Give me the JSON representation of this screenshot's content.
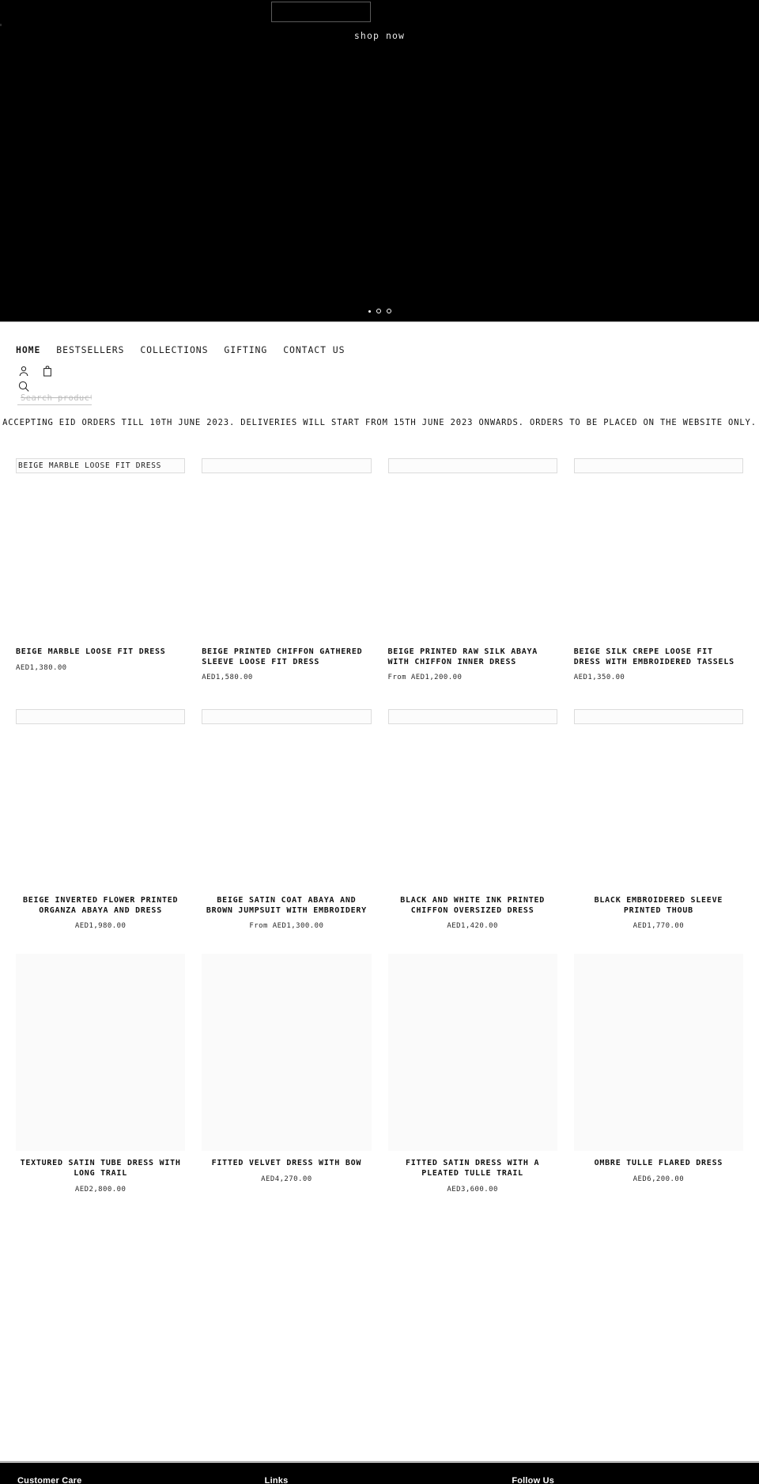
{
  "hero": {
    "shop_now_label": "shop now",
    "slider_dots": [
      "dot",
      "ring",
      "ring"
    ],
    "background_color": "#000000"
  },
  "header": {
    "nav": [
      {
        "label": "HOME",
        "active": true
      },
      {
        "label": "BESTSELLERS",
        "active": false
      },
      {
        "label": "COLLECTIONS",
        "active": false
      },
      {
        "label": "GIFTING",
        "active": false
      },
      {
        "label": "CONTACT US",
        "active": false
      }
    ],
    "icons": [
      {
        "name": "account-icon"
      },
      {
        "name": "bag-icon"
      },
      {
        "name": "search-icon"
      }
    ],
    "search": {
      "placeholder": "Search product",
      "value": ""
    },
    "announcement": "ACCEPTING EID ORDERS TILL 10TH JUNE 2023. DELIVERIES WILL START FROM 15TH JUNE 2023 ONWARDS. ORDERS TO BE PLACED ON THE WEBSITE ONLY."
  },
  "products": {
    "row1": [
      {
        "alt": "BEIGE MARBLE LOOSE FIT DRESS",
        "title": "BEIGE MARBLE LOOSE FIT DRESS",
        "price": "AED1,380.00"
      },
      {
        "alt": "",
        "title": "BEIGE PRINTED CHIFFON GATHERED SLEEVE LOOSE FIT DRESS",
        "price": "AED1,580.00"
      },
      {
        "alt": "",
        "title": "BEIGE PRINTED RAW SILK ABAYA WITH CHIFFON INNER DRESS",
        "price": "From AED1,200.00"
      },
      {
        "alt": "",
        "title": "BEIGE SILK CREPE LOOSE FIT DRESS WITH EMBROIDERED TASSELS",
        "price": "AED1,350.00"
      }
    ],
    "row2": [
      {
        "alt": "",
        "title": "BEIGE INVERTED FLOWER PRINTED ORGANZA ABAYA AND DRESS",
        "price": "AED1,980.00"
      },
      {
        "alt": "",
        "title": "BEIGE SATIN COAT ABAYA AND BROWN JUMPSUIT WITH EMBROIDERY",
        "price": "From AED1,300.00"
      },
      {
        "alt": "",
        "title": "BLACK AND WHITE INK PRINTED CHIFFON OVERSIZED DRESS",
        "price": "AED1,420.00"
      },
      {
        "alt": "",
        "title": "BLACK EMBROIDERED SLEEVE PRINTED THOUB",
        "price": "AED1,770.00"
      }
    ],
    "row3": [
      {
        "title": "TEXTURED SATIN TUBE DRESS WITH LONG TRAIL",
        "price": "AED2,800.00"
      },
      {
        "title": "FITTED VELVET DRESS WITH BOW",
        "price": "AED4,270.00"
      },
      {
        "title": "FITTED SATIN DRESS WITH A PLEATED TULLE TRAIL",
        "price": "AED3,600.00"
      },
      {
        "title": "OMBRE TULLE FLARED DRESS",
        "price": "AED6,200.00"
      }
    ]
  },
  "footer": {
    "columns": [
      {
        "heading": "Customer Care"
      },
      {
        "heading": "Links"
      },
      {
        "heading": "Follow Us"
      }
    ],
    "background_color": "#000000"
  }
}
